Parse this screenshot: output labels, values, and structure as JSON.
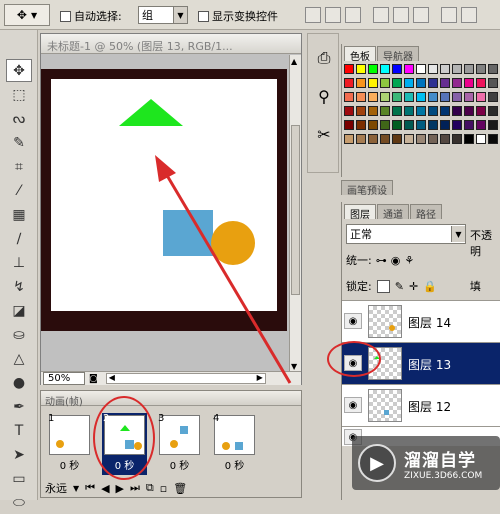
{
  "options_bar": {
    "auto_select_label": "自动选择:",
    "auto_select_value": "组",
    "show_transform_label": "显示变换控件"
  },
  "document": {
    "title": "未标题-1 @ 50% (图层 13, RGB/1...",
    "zoom": "50%"
  },
  "animation_panel": {
    "title": "动画(帧)",
    "frames": [
      {
        "num": "1",
        "delay": "0 秒"
      },
      {
        "num": "2",
        "delay": "0 秒"
      },
      {
        "num": "3",
        "delay": "0 秒"
      },
      {
        "num": "4",
        "delay": "0 秒"
      }
    ],
    "loop_value": "永远"
  },
  "swatch_panel": {
    "tabs": [
      "色板",
      "导航器"
    ]
  },
  "brush_panel": {
    "tab": "画笔预设"
  },
  "layers_panel": {
    "tabs": [
      "图层",
      "通道",
      "路径"
    ],
    "blend_mode": "正常",
    "opacity_label": "不透明",
    "unify_label": "统一:",
    "lock_label": "锁定:",
    "fill_label": "填",
    "layers": [
      {
        "name": "图层 14"
      },
      {
        "name": "图层 13"
      },
      {
        "name": "图层 12"
      }
    ]
  },
  "watermark": {
    "brand": "溜溜自学",
    "url": "ZIXUE.3D66.COM"
  },
  "colors": {
    "triangle": "#1ee61e",
    "square": "#5aa6d2",
    "circle": "#e8a010",
    "annotation": "#d92b2b",
    "selection": "#0a246a"
  }
}
